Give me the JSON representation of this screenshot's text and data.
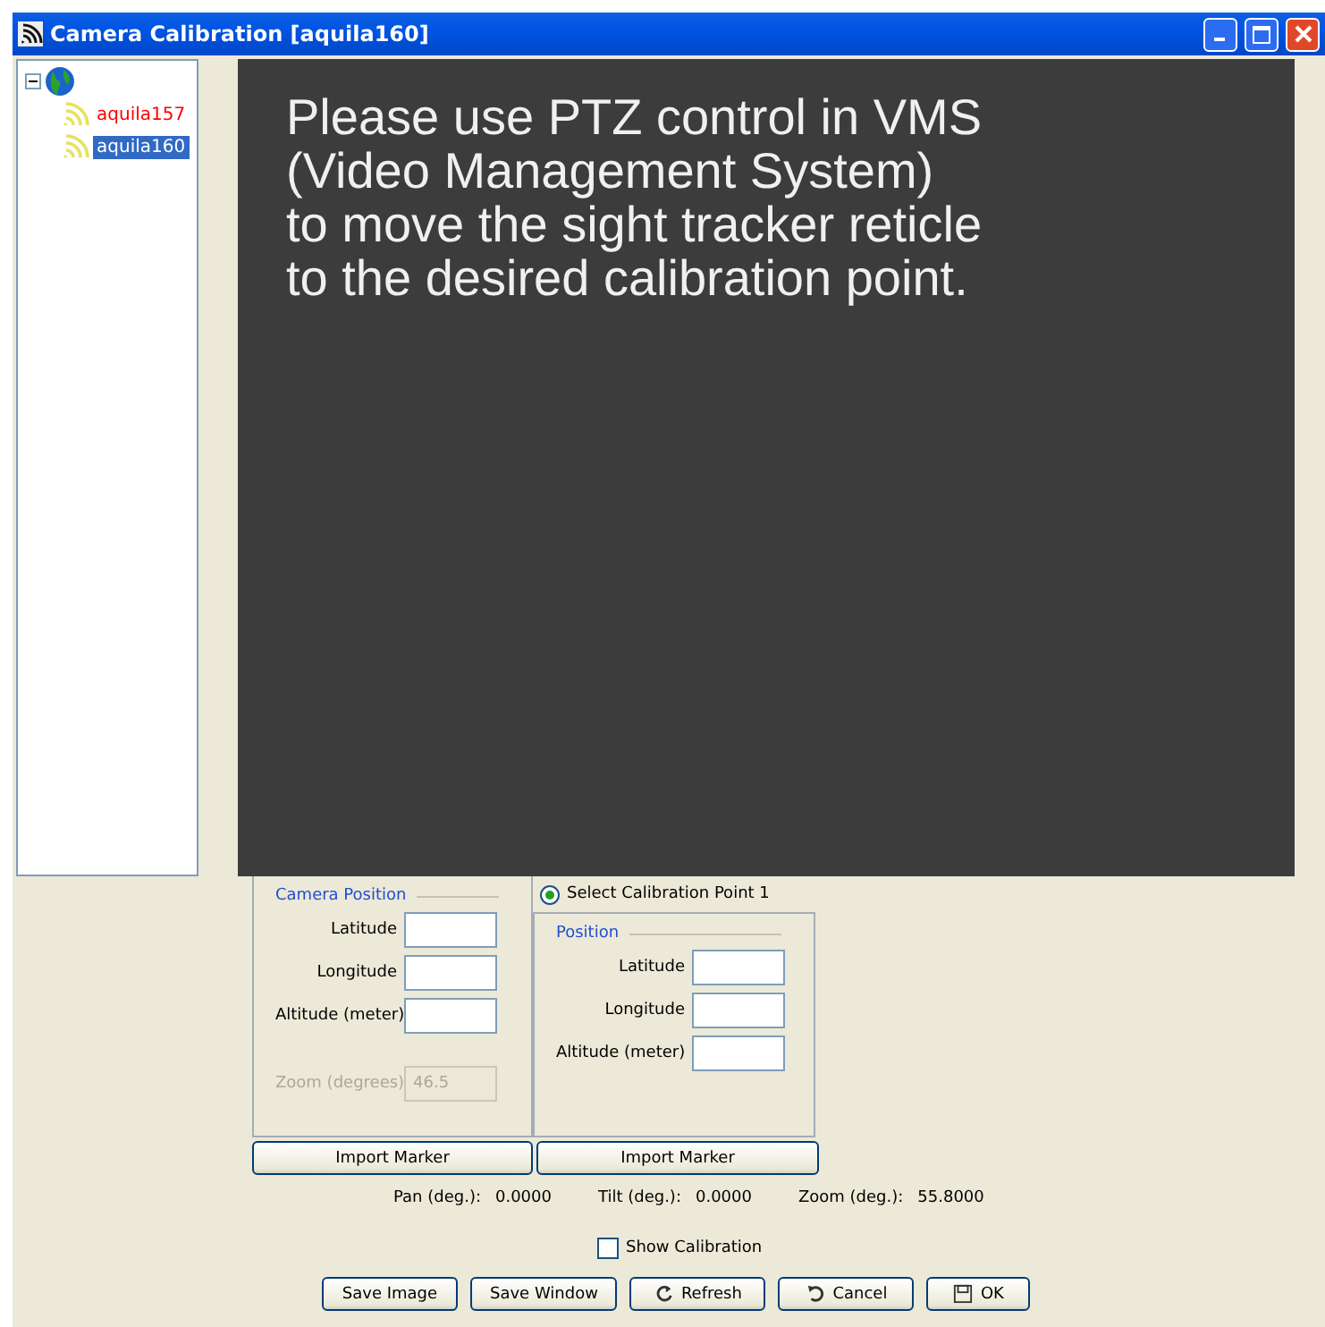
{
  "window": {
    "title": "Camera Calibration [aquila160]"
  },
  "tree": {
    "expanded": true,
    "children": [
      {
        "label": "aquila157",
        "selected": false,
        "color": "#ff0000"
      },
      {
        "label": "aquila160",
        "selected": true
      }
    ]
  },
  "video": {
    "message": [
      "Please use PTZ control in VMS",
      "(Video Management System)",
      "to move the sight tracker reticle",
      "to the desired calibration point."
    ]
  },
  "camera_position": {
    "title": "Camera Position",
    "fields": [
      {
        "label": "Latitude",
        "disabled": false
      },
      {
        "label": "Longitude",
        "disabled": false
      },
      {
        "label": "Altitude (meter)",
        "disabled": false
      },
      {
        "label": "Zoom (degrees)",
        "value": "46.5",
        "disabled": true
      }
    ],
    "button": "Import Marker"
  },
  "calibration_point": {
    "radio": {
      "label": "Select Calibration Point 1",
      "selected": true
    },
    "title": "Position",
    "fields": [
      {
        "label": "Latitude"
      },
      {
        "label": "Longitude"
      },
      {
        "label": "Altitude (meter)"
      }
    ],
    "button": "Import Marker"
  },
  "readouts": [
    {
      "label": "Pan (deg.):",
      "value": "0.0000"
    },
    {
      "label": "Tilt (deg.):",
      "value": "0.0000"
    },
    {
      "label": "Zoom (deg.):",
      "value": "55.8000"
    }
  ],
  "show_calibration": {
    "label": "Show Calibration",
    "checked": false
  },
  "buttons": [
    {
      "label": "Save Image",
      "kind": "plain"
    },
    {
      "label": "Save Window",
      "kind": "plain"
    },
    {
      "label": "Refresh",
      "kind": "refresh"
    },
    {
      "label": "Cancel",
      "kind": "cancel"
    },
    {
      "label": "OK",
      "kind": "ok"
    }
  ]
}
